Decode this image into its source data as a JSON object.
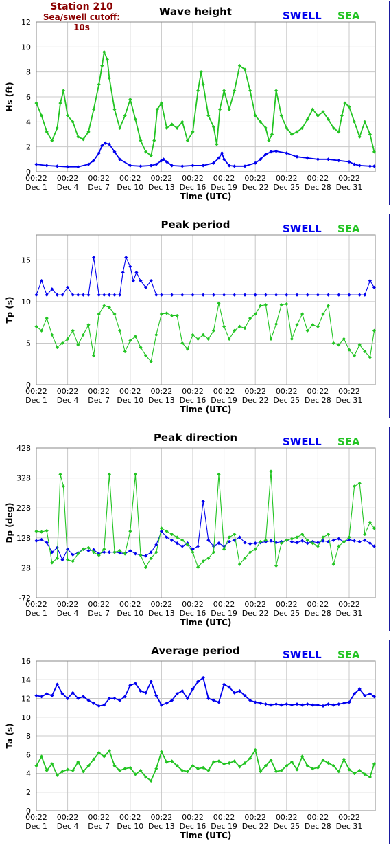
{
  "header": {
    "station": "Station 210",
    "cutoff": "Sea/swell cutoff: 10s"
  },
  "legend": {
    "swell": "SWELL",
    "sea": "SEA"
  },
  "colors": {
    "swell": "#0000ee",
    "sea": "#22c422",
    "frame": "#1a1aa0",
    "grid": "#c8c8c8"
  },
  "x_axis": {
    "label": "Time (UTC)",
    "tick_times": [
      "00:22",
      "00:22",
      "00:22",
      "00:22",
      "00:22",
      "00:22",
      "00:22",
      "00:22",
      "00:22",
      "00:22",
      "00:22"
    ],
    "tick_dates": [
      "Dec 1",
      "Dec 4",
      "Dec 7",
      "Dec 10",
      "Dec 13",
      "Dec 16",
      "Dec 19",
      "Dec 22",
      "Dec 25",
      "Dec 28",
      "Dec 31"
    ]
  },
  "chart_data": [
    {
      "type": "line",
      "title": "Wave height",
      "ylabel": "Hs (ft)",
      "ylim": [
        0,
        12
      ],
      "yticks": [
        0,
        2,
        4,
        6,
        8,
        10,
        12
      ],
      "x_days_range": [
        1,
        33.5
      ],
      "series": [
        {
          "name": "SWELL",
          "color": "#0000ee",
          "x": [
            1,
            2,
            3,
            4,
            5,
            6,
            6.5,
            7,
            7.3,
            7.6,
            8,
            8.5,
            9,
            10,
            11,
            12,
            12.5,
            13,
            13.2,
            13.5,
            14,
            15,
            16,
            17,
            18,
            18.5,
            18.8,
            19,
            19.5,
            20,
            21,
            22,
            22.5,
            23,
            23.5,
            24,
            25,
            26,
            27,
            28,
            29,
            30,
            31,
            31.5,
            32,
            33,
            33.4
          ],
          "y": [
            0.6,
            0.5,
            0.45,
            0.4,
            0.4,
            0.6,
            0.9,
            1.5,
            2.1,
            2.3,
            2.2,
            1.6,
            1,
            0.5,
            0.45,
            0.5,
            0.6,
            0.9,
            1.0,
            0.8,
            0.5,
            0.45,
            0.5,
            0.5,
            0.7,
            1.1,
            1.5,
            1.0,
            0.5,
            0.45,
            0.45,
            0.7,
            1,
            1.4,
            1.6,
            1.65,
            1.5,
            1.2,
            1.1,
            1.0,
            1.0,
            0.9,
            0.8,
            0.6,
            0.5,
            0.45,
            0.45
          ]
        },
        {
          "name": "SEA",
          "color": "#22c422",
          "x": [
            1,
            1.5,
            2,
            2.5,
            3,
            3.3,
            3.6,
            4,
            4.5,
            5,
            5.5,
            6,
            6.5,
            7,
            7.3,
            7.5,
            7.8,
            8,
            8.5,
            9,
            9.5,
            10,
            10.5,
            11,
            11.5,
            12,
            12.3,
            12.6,
            13,
            13.5,
            14,
            14.5,
            15,
            15.5,
            16,
            16.5,
            16.8,
            17,
            17.5,
            18,
            18.3,
            18.6,
            19,
            19.5,
            20,
            20.5,
            21,
            21.5,
            22,
            22.5,
            23,
            23.3,
            23.6,
            24,
            24.5,
            25,
            25.5,
            26,
            26.5,
            27,
            27.5,
            28,
            28.5,
            29,
            29.5,
            30,
            30.3,
            30.6,
            31,
            31.5,
            32,
            32.5,
            33,
            33.4
          ],
          "y": [
            5.5,
            4.5,
            3.2,
            2.5,
            3.5,
            5.5,
            6.5,
            4.5,
            4,
            2.8,
            2.6,
            3.2,
            5,
            7,
            8.5,
            9.6,
            9,
            7.5,
            5,
            3.5,
            4.5,
            5.8,
            4.2,
            2.5,
            1.6,
            1.3,
            2.5,
            5,
            5.5,
            3.5,
            3.8,
            3.5,
            4,
            2.5,
            3.2,
            6.5,
            8,
            7,
            4.5,
            3.6,
            2.2,
            5,
            6.5,
            5,
            6.5,
            8.5,
            8.2,
            6.5,
            4.5,
            4,
            3.5,
            2.5,
            3,
            6.5,
            4.5,
            3.5,
            3,
            3.2,
            3.5,
            4.2,
            5,
            4.5,
            4.8,
            4.2,
            3.5,
            3.2,
            4.5,
            5.5,
            5.2,
            4,
            2.8,
            4,
            3,
            1.6
          ]
        }
      ]
    },
    {
      "type": "scatter",
      "title": "Peak period",
      "ylabel": "Tp (s)",
      "ylim": [
        0,
        18
      ],
      "yticks": [
        0,
        5,
        10,
        15
      ],
      "x_days_range": [
        1,
        33.5
      ],
      "series": [
        {
          "name": "SWELL",
          "color": "#0000ee",
          "x": [
            1,
            1.5,
            2,
            2.5,
            3,
            3.5,
            4,
            4.5,
            5,
            5.5,
            6,
            6.5,
            7,
            7.5,
            8,
            8.5,
            9,
            9.3,
            9.6,
            10,
            10.3,
            10.6,
            11,
            11.5,
            12,
            12.5,
            13,
            14,
            15,
            16,
            17,
            18,
            19,
            20,
            21,
            22,
            23,
            24,
            25,
            26,
            27,
            28,
            29,
            30,
            31,
            32,
            32.5,
            33,
            33.4
          ],
          "y": [
            10.8,
            12.5,
            10.8,
            11.5,
            10.8,
            10.8,
            11.7,
            10.8,
            10.8,
            10.8,
            10.8,
            15.3,
            10.8,
            10.8,
            10.8,
            10.8,
            10.8,
            13.5,
            15.3,
            14.2,
            12.5,
            13.5,
            12.5,
            11.7,
            12.5,
            10.8,
            10.8,
            10.8,
            10.8,
            10.8,
            10.8,
            10.8,
            10.8,
            10.8,
            10.8,
            10.8,
            10.8,
            10.8,
            10.8,
            10.8,
            10.8,
            10.8,
            10.8,
            10.8,
            10.8,
            10.8,
            10.8,
            12.5,
            11.7
          ]
        },
        {
          "name": "SEA",
          "color": "#22c422",
          "x": [
            1,
            1.5,
            2,
            2.5,
            3,
            3.5,
            4,
            4.5,
            5,
            5.5,
            6,
            6.5,
            7,
            7.5,
            8,
            8.5,
            9,
            9.5,
            10,
            10.5,
            11,
            11.5,
            12,
            12.5,
            13,
            13.5,
            14,
            14.5,
            15,
            15.5,
            16,
            16.5,
            17,
            17.5,
            18,
            18.5,
            19,
            19.5,
            20,
            20.5,
            21,
            21.5,
            22,
            22.5,
            23,
            23.5,
            24,
            24.5,
            25,
            25.5,
            26,
            26.5,
            27,
            27.5,
            28,
            28.5,
            29,
            29.5,
            30,
            30.5,
            31,
            31.5,
            32,
            32.5,
            33,
            33.4
          ],
          "y": [
            7,
            6.5,
            8,
            6,
            4.5,
            5,
            5.5,
            6.5,
            4.8,
            6,
            7.2,
            3.5,
            8.5,
            9.5,
            9.3,
            8.5,
            6.5,
            4,
            5.3,
            5.8,
            4.5,
            3.5,
            2.8,
            6,
            8.5,
            8.6,
            8.3,
            8.3,
            5,
            4.3,
            6,
            5.5,
            6,
            5.5,
            6.5,
            9.8,
            7,
            5.5,
            6.5,
            7,
            6.8,
            8,
            8.5,
            9.5,
            9.6,
            5.5,
            7.3,
            9.6,
            9.7,
            5.5,
            7.2,
            8.5,
            6.5,
            7.2,
            7,
            8.5,
            9.5,
            5,
            4.8,
            5.5,
            4.2,
            3.5,
            4.8,
            4,
            3.3,
            6.5
          ]
        }
      ]
    },
    {
      "type": "scatter",
      "title": "Peak direction",
      "ylabel": "Dp (deg)",
      "ylim": [
        -72,
        428
      ],
      "yticks": [
        -72,
        28,
        128,
        228,
        328,
        428
      ],
      "x_days_range": [
        1,
        33.5
      ],
      "series": [
        {
          "name": "SWELL",
          "color": "#0000ee",
          "x": [
            1,
            1.5,
            2,
            2.5,
            3,
            3.5,
            4,
            4.5,
            5,
            5.5,
            6,
            6.5,
            7,
            7.5,
            8,
            8.5,
            9,
            9.5,
            10,
            10.5,
            11,
            11.5,
            12,
            12.5,
            13,
            13.5,
            14,
            14.5,
            15,
            15.5,
            16,
            16.5,
            17,
            17.5,
            18,
            18.5,
            19,
            19.5,
            20,
            20.5,
            21,
            21.5,
            22,
            22.5,
            23,
            23.5,
            24,
            24.5,
            25,
            25.5,
            26,
            26.5,
            27,
            27.5,
            28,
            28.5,
            29,
            29.5,
            30,
            30.5,
            31,
            31.5,
            32,
            32.5,
            33,
            33.4
          ],
          "y": [
            118,
            122,
            112,
            80,
            95,
            55,
            90,
            72,
            78,
            90,
            85,
            88,
            75,
            80,
            80,
            80,
            78,
            75,
            85,
            75,
            70,
            68,
            80,
            105,
            150,
            130,
            120,
            110,
            100,
            110,
            90,
            100,
            250,
            120,
            100,
            110,
            100,
            115,
            120,
            130,
            112,
            108,
            110,
            112,
            115,
            118,
            112,
            115,
            120,
            115,
            112,
            118,
            110,
            115,
            112,
            118,
            115,
            120,
            125,
            115,
            122,
            118,
            115,
            120,
            110,
            100
          ]
        },
        {
          "name": "SEA",
          "color": "#22c422",
          "x": [
            1,
            1.5,
            2,
            2.5,
            3,
            3.3,
            3.6,
            4,
            4.5,
            5,
            5.5,
            6,
            6.5,
            7,
            7.5,
            8,
            8.5,
            9,
            9.5,
            10,
            10.5,
            11,
            11.5,
            12,
            12.5,
            13,
            13.5,
            14,
            14.5,
            15,
            15.5,
            16,
            16.5,
            17,
            17.5,
            18,
            18.5,
            19,
            19.5,
            20,
            20.5,
            21,
            21.5,
            22,
            22.5,
            23,
            23.5,
            24,
            24.5,
            25,
            25.5,
            26,
            26.5,
            27,
            27.5,
            28,
            28.5,
            29,
            29.5,
            30,
            30.5,
            31,
            31.5,
            32,
            32.5,
            33,
            33.4
          ],
          "y": [
            150,
            148,
            152,
            45,
            60,
            340,
            300,
            55,
            50,
            75,
            90,
            95,
            80,
            70,
            90,
            340,
            80,
            85,
            75,
            150,
            340,
            70,
            30,
            60,
            80,
            160,
            150,
            140,
            130,
            120,
            105,
            80,
            30,
            50,
            60,
            80,
            340,
            90,
            130,
            140,
            40,
            60,
            80,
            90,
            115,
            120,
            350,
            35,
            110,
            120,
            125,
            130,
            140,
            120,
            110,
            100,
            130,
            140,
            40,
            100,
            115,
            130,
            300,
            310,
            140,
            180,
            160
          ]
        }
      ]
    },
    {
      "type": "line",
      "title": "Average period",
      "ylabel": "Ta (s)",
      "ylim": [
        0,
        16
      ],
      "yticks": [
        0,
        2,
        4,
        6,
        8,
        10,
        12,
        14,
        16
      ],
      "x_days_range": [
        1,
        33.5
      ],
      "series": [
        {
          "name": "SWELL",
          "color": "#0000ee",
          "x": [
            1,
            1.5,
            2,
            2.5,
            3,
            3.5,
            4,
            4.5,
            5,
            5.5,
            6,
            6.5,
            7,
            7.5,
            8,
            8.5,
            9,
            9.5,
            10,
            10.5,
            11,
            11.5,
            12,
            12.5,
            13,
            13.5,
            14,
            14.5,
            15,
            15.5,
            16,
            16.5,
            17,
            17.5,
            18,
            18.5,
            19,
            19.5,
            20,
            20.5,
            21,
            21.5,
            22,
            22.5,
            23,
            23.5,
            24,
            24.5,
            25,
            25.5,
            26,
            26.5,
            27,
            27.5,
            28,
            28.5,
            29,
            29.5,
            30,
            30.5,
            31,
            31.5,
            32,
            32.5,
            33,
            33.4
          ],
          "y": [
            12.3,
            12.2,
            12.5,
            12.3,
            13.5,
            12.5,
            12,
            12.6,
            12,
            12.2,
            11.8,
            11.5,
            11.2,
            11.3,
            12,
            12,
            11.8,
            12.2,
            13.4,
            13.6,
            12.8,
            12.6,
            13.8,
            12.3,
            11.3,
            11.5,
            11.8,
            12.5,
            12.8,
            12,
            13,
            13.8,
            14.2,
            12,
            11.8,
            11.6,
            13.5,
            13.2,
            12.6,
            12.8,
            12.3,
            11.8,
            11.6,
            11.5,
            11.4,
            11.3,
            11.4,
            11.3,
            11.4,
            11.3,
            11.4,
            11.3,
            11.4,
            11.3,
            11.3,
            11.2,
            11.4,
            11.3,
            11.4,
            11.5,
            11.6,
            12.5,
            13,
            12.3,
            12.5,
            12.2
          ]
        },
        {
          "name": "SEA",
          "color": "#22c422",
          "x": [
            1,
            1.5,
            2,
            2.5,
            3,
            3.5,
            4,
            4.5,
            5,
            5.5,
            6,
            6.5,
            7,
            7.5,
            8,
            8.5,
            9,
            9.5,
            10,
            10.5,
            11,
            11.5,
            12,
            12.5,
            13,
            13.5,
            14,
            14.5,
            15,
            15.5,
            16,
            16.5,
            17,
            17.5,
            18,
            18.5,
            19,
            19.5,
            20,
            20.5,
            21,
            21.5,
            22,
            22.5,
            23,
            23.5,
            24,
            24.5,
            25,
            25.5,
            26,
            26.5,
            27,
            27.5,
            28,
            28.5,
            29,
            29.5,
            30,
            30.5,
            31,
            31.5,
            32,
            32.5,
            33,
            33.4
          ],
          "y": [
            4.8,
            5.8,
            4.3,
            5,
            3.8,
            4.2,
            4.4,
            4.3,
            5.2,
            4.2,
            4.8,
            5.5,
            6.2,
            5.8,
            6.4,
            4.8,
            4.3,
            4.5,
            4.6,
            3.9,
            4.3,
            3.6,
            3.2,
            4.5,
            6.3,
            5.2,
            5.3,
            4.8,
            4.3,
            4.2,
            4.8,
            4.5,
            4.6,
            4.3,
            5.2,
            5.3,
            5,
            5.1,
            5.3,
            4.7,
            5.1,
            5.6,
            6.5,
            4.2,
            4.8,
            5.4,
            4.2,
            4.3,
            4.8,
            5.2,
            4.4,
            5.8,
            4.8,
            4.5,
            4.6,
            5.4,
            5.1,
            4.8,
            4.2,
            5.5,
            4.4,
            4,
            4.3,
            3.9,
            3.6,
            5
          ]
        }
      ]
    }
  ]
}
